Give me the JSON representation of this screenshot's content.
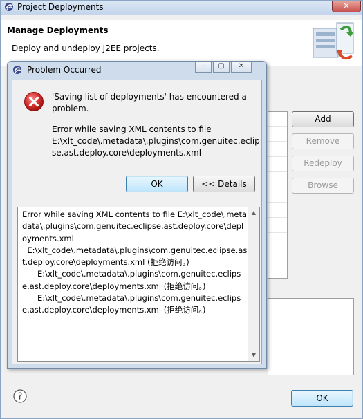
{
  "window": {
    "title": "Project Deployments",
    "close_glyph": "✕",
    "header_title": "Manage Deployments",
    "header_description": "Deploy and undeploy J2EE projects.",
    "buttons": {
      "add": "Add",
      "remove": "Remove",
      "redeploy": "Redeploy",
      "browse": "Browse",
      "ok": "OK"
    },
    "help_icon": "help-question-icon"
  },
  "dialog": {
    "title": "Problem Occurred",
    "controls": {
      "minimize": "–",
      "restore": "▢",
      "close": "✕"
    },
    "message": "'Saving list of deployments' has encountered a problem.",
    "detail_summary": "Error while saving XML contents to file\nE:\\xlt_code\\.metadata\\.plugins\\com.genuitec.eclipse.ast.deploy.core\\deployments.xml",
    "ok_label": "OK",
    "details_label": "<< Details",
    "details_lines": [
      "Error while saving XML contents to file E:\\xlt_code\\.metadata\\.plugins\\com.genuitec.eclipse.ast.deploy.core\\deployments.xml",
      "  E:\\xlt_code\\.metadata\\.plugins\\com.genuitec.eclipse.ast.deploy.core\\deployments.xml (拒绝访问。)",
      "      E:\\xlt_code\\.metadata\\.plugins\\com.genuitec.eclipse.ast.deploy.core\\deployments.xml (拒绝访问。)",
      "      E:\\xlt_code\\.metadata\\.plugins\\com.genuitec.eclipse.ast.deploy.core\\deployments.xml (拒绝访问。)"
    ],
    "icon": "error-icon"
  },
  "colors": {
    "titlebar": "#c3d5ec",
    "error_red": "#d62b2b",
    "default_button": "#bee6fd"
  }
}
